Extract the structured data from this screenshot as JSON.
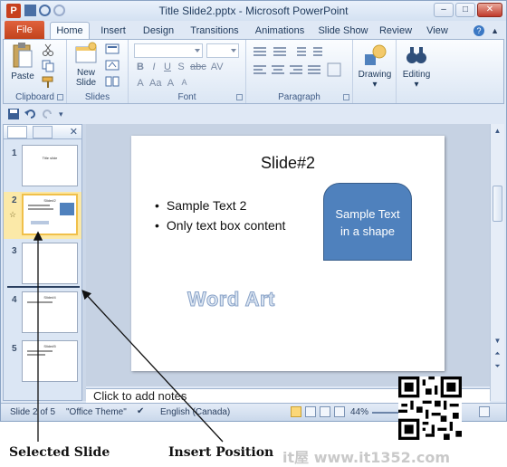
{
  "window": {
    "title": "Title Slide2.pptx - Microsoft PowerPoint",
    "controls": [
      "–",
      "□",
      "✕"
    ]
  },
  "ribbon": {
    "file_tab": "File",
    "tabs": [
      "Home",
      "Insert",
      "Design",
      "Transitions",
      "Animations",
      "Slide Show",
      "Review",
      "View"
    ],
    "active_tab": "Home",
    "groups": {
      "clipboard": {
        "label": "Clipboard",
        "paste": "Paste"
      },
      "slides": {
        "label": "Slides",
        "new_slide_line1": "New",
        "new_slide_line2": "Slide"
      },
      "font": {
        "label": "Font",
        "row1": [
          "B",
          "I",
          "U",
          "S",
          "abc",
          "AV"
        ],
        "row2": [
          "A",
          "Aa",
          "A",
          "A"
        ]
      },
      "paragraph": {
        "label": "Paragraph"
      },
      "drawing": {
        "label": "Drawing"
      },
      "editing": {
        "label": "Editing"
      }
    }
  },
  "slides_pane": {
    "thumbnails": [
      {
        "number": "1",
        "title": "Title slide",
        "selected": false
      },
      {
        "number": "2",
        "title": "Slide#2",
        "selected": true
      },
      {
        "number": "3",
        "title": "",
        "selected": false
      },
      {
        "number": "4",
        "title": "Slide#4",
        "selected": false
      },
      {
        "number": "5",
        "title": "Slide#5",
        "selected": false
      }
    ]
  },
  "slide": {
    "title": "Slide#2",
    "bullets": [
      "Sample Text 2",
      "Only text box content"
    ],
    "shape_text_line1": "Sample Text",
    "shape_text_line2": "in a shape",
    "wordart": "Word Art"
  },
  "notes": {
    "placeholder": "Click to add notes"
  },
  "status_bar": {
    "slide_info": "Slide 2 of 5",
    "theme": "\"Office Theme\"",
    "language": "English (Canada)",
    "zoom": "44%"
  },
  "callouts": {
    "selected_slide": "Selected Slide",
    "insert_position": "Insert Position"
  },
  "watermark": "it屋 www.it1352.com",
  "colors": {
    "file_tab": "#c7401f",
    "shape_fill": "#4f81bd",
    "selection": "#f0c04a"
  }
}
